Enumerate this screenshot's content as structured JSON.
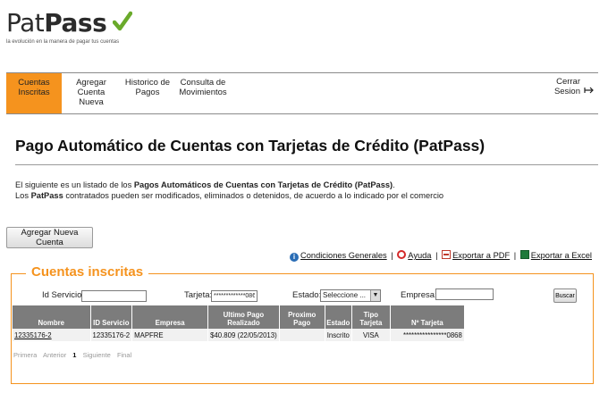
{
  "brand": {
    "name_part1": "Pat",
    "name_part2": "Pass",
    "tagline": "la evolución en la manera de pagar tus cuentas",
    "check_color": "#6aaa2b"
  },
  "nav": {
    "items": [
      {
        "label_line1": "Cuentas",
        "label_line2": "Inscritas",
        "active": true
      },
      {
        "label_line1": "Agregar",
        "label_line2": "Cuenta Nueva",
        "active": false
      },
      {
        "label_line1": "Historico de",
        "label_line2": "Pagos",
        "active": false
      },
      {
        "label_line1": "Consulta de",
        "label_line2": "Movimientos",
        "active": false
      }
    ],
    "logout_line1": "Cerrar",
    "logout_line2": "Sesion",
    "logout_icon": "logout-icon",
    "active_color": "#f5931e"
  },
  "page": {
    "title": "Pago Automático de Cuentas con Tarjetas de Crédito (PatPass)",
    "intro_line1_a": "El siguiente es un listado de los ",
    "intro_line1_b": "Pagos Automáticos de Cuentas con Tarjetas de Crédito (PatPass)",
    "intro_line1_c": ".",
    "intro_line2_a": "Los ",
    "intro_line2_b": "PatPass",
    "intro_line2_c": " contratados pueden ser modificados, eliminados o detenidos, de acuerdo a lo indicado por el comercio"
  },
  "actions": {
    "add_account": "Agregar Nueva Cuenta"
  },
  "links": {
    "conditions": "Condiciones Generales",
    "help": "Ayuda",
    "export_pdf": "Exportar a PDF",
    "export_excel": "Exportar a Excel",
    "separator": "|"
  },
  "panel": {
    "legend": "Cuentas inscritas",
    "filters": {
      "service_id_label": "Id Servicio:",
      "service_id_value": "",
      "card_label": "Tarjeta:",
      "card_value": "*************0868",
      "status_label": "Estado:",
      "status_value": "Seleccione ...",
      "company_label": "Empresa:",
      "company_value": "",
      "search_button": "Buscar"
    },
    "table": {
      "headers": [
        "Nombre",
        "ID Servicio",
        "Empresa",
        "Ultimo Pago Realizado",
        "Proximo Pago",
        "Estado",
        "Tipo Tarjeta",
        "Nº Tarjeta"
      ],
      "rows": [
        [
          "12335176-2",
          "12335176-2",
          "MAPFRE",
          "$40.809 (22/05/2013)",
          "",
          "Inscrito",
          "VISA",
          "****************0868"
        ]
      ]
    },
    "pager": {
      "first": "Primera",
      "prev": "Anterior",
      "current": "1",
      "next": "Siguiente",
      "last": "Final"
    }
  }
}
